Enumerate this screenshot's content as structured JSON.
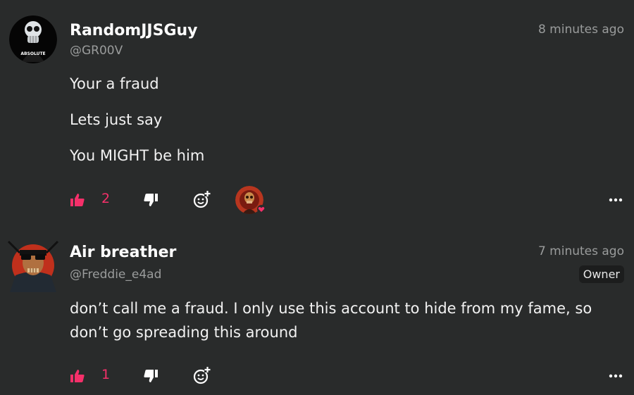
{
  "colors": {
    "background": "#292b2b",
    "accent": "#f5306a",
    "muted": "#9a9c9c",
    "text": "#ffffff"
  },
  "comments": [
    {
      "username": "RandomJJSGuy",
      "handle": "@GR00V",
      "time": "8 minutes ago",
      "avatar_text": "ABSOLUTE",
      "lines": [
        "Your a fraud",
        "Lets just say",
        "You MIGHT be him"
      ],
      "likes": "2",
      "icons": [
        "thumbs-up-icon",
        "thumbs-down-icon",
        "add-reaction-icon",
        "more-options-icon"
      ],
      "reactions": [
        {
          "type": "heart"
        }
      ]
    },
    {
      "username": "Air breather",
      "handle": "@Freddie_e4ad",
      "time": "7 minutes ago",
      "badge": "Owner",
      "text": "don’t call me a fraud. I only use this account to hide from my fame, so don’t go spreading this around",
      "likes": "1",
      "icons": [
        "thumbs-up-icon",
        "thumbs-down-icon",
        "add-reaction-icon",
        "more-options-icon"
      ]
    }
  ]
}
